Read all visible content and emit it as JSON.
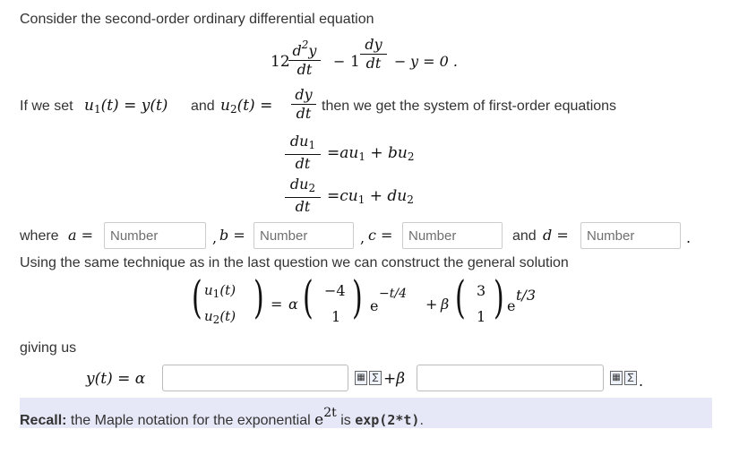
{
  "intro": "Consider the second-order ordinary differential equation",
  "ode": {
    "coef1": "12",
    "coef2": "1",
    "tail": "y = 0 ."
  },
  "setup": {
    "prefix": "If we set",
    "and": "and",
    "suffix": "then we get the system of first-order equations"
  },
  "where": {
    "label": "where",
    "and_word": "and",
    "placeholder": "Number",
    "vars": [
      "a",
      "b",
      "c",
      "d"
    ]
  },
  "technique": "Using the same technique as in the last question we can construct the general solution",
  "general_solution": {
    "alpha": "α",
    "beta": "β",
    "v1": [
      "−4",
      "1"
    ],
    "exp1": "−t/4",
    "v2": [
      "3",
      "1"
    ],
    "exp2": "t/3"
  },
  "giving": "giving us",
  "answer": {
    "lhs": "y(t) = α",
    "plus_beta": "+β"
  },
  "recall": {
    "bold": "Recall:",
    "text": "the Maple notation for the exponential",
    "exp_base": "e",
    "exp_power": "2t",
    "is": "is",
    "code": "exp(2*t)",
    "end": "."
  },
  "icons": [
    "preview-icon",
    "help-icon"
  ]
}
